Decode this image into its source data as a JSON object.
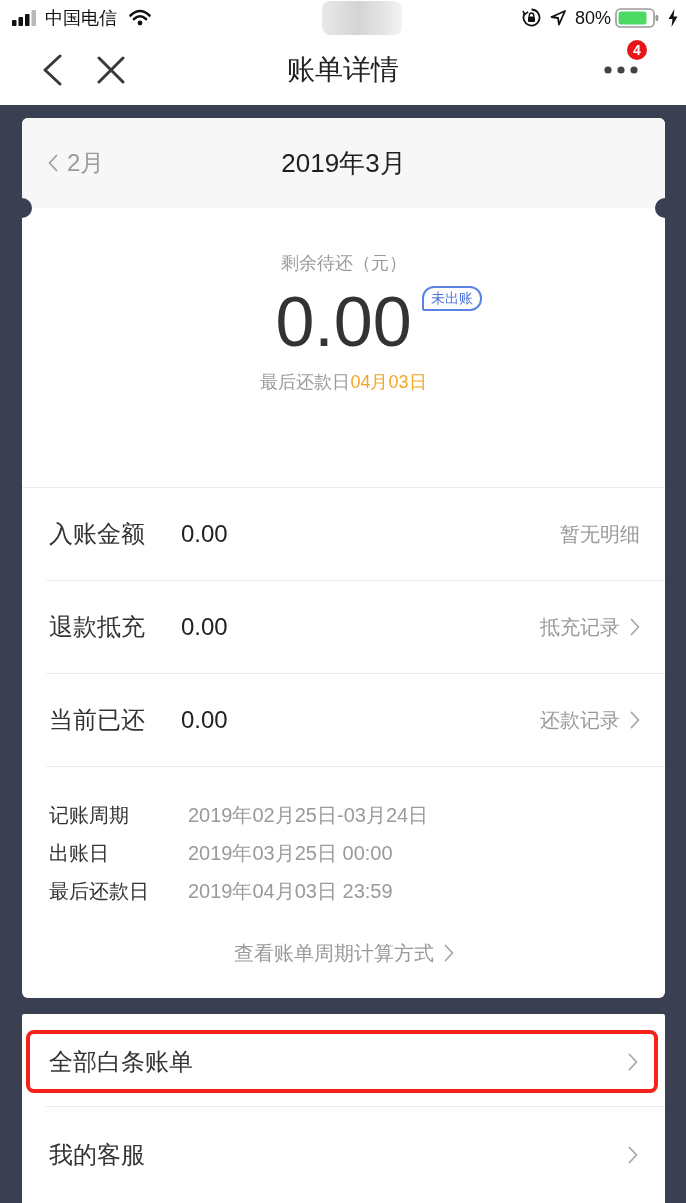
{
  "status_bar": {
    "carrier": "中国电信",
    "battery_text": "80%"
  },
  "nav_bar": {
    "title": "账单详情",
    "badge": "4"
  },
  "bill_header": {
    "prev_month": "2月",
    "month": "2019年3月"
  },
  "summary": {
    "label": "剩余待还（元）",
    "amount": "0.00",
    "tag": "未出账",
    "due_label": "最后还款日",
    "due_date": "04月03日"
  },
  "amount_rows": [
    {
      "label": "入账金额",
      "value": "0.00",
      "kind": "note",
      "action": "暂无明细"
    },
    {
      "label": "退款抵充",
      "value": "0.00",
      "kind": "link",
      "action": "抵充记录"
    },
    {
      "label": "当前已还",
      "value": "0.00",
      "kind": "link",
      "action": "还款记录"
    }
  ],
  "details": [
    {
      "label": "记账周期",
      "value": "2019年02月25日-03月24日"
    },
    {
      "label": "出账日",
      "value": "2019年03月25日 00:00"
    },
    {
      "label": "最后还款日",
      "value": "2019年04月03日 23:59"
    }
  ],
  "cycle_link": "查看账单周期计算方式",
  "menu": [
    {
      "label": "全部白条账单",
      "highlighted": true
    },
    {
      "label": "我的客服",
      "highlighted": false
    }
  ]
}
